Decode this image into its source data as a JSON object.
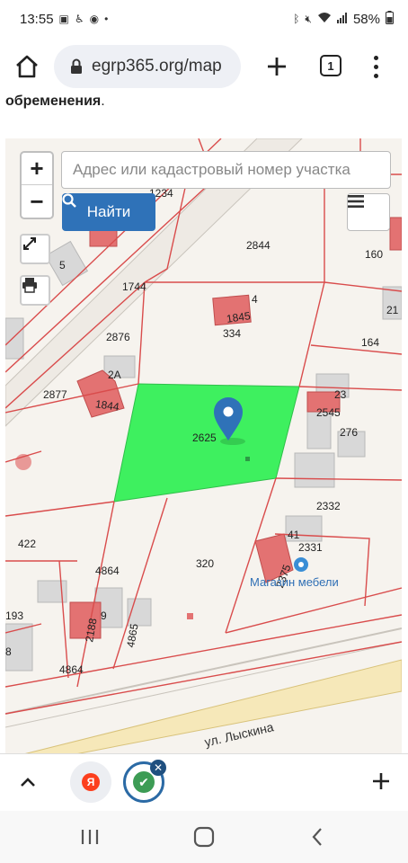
{
  "status_bar": {
    "time": "13:55",
    "battery": "58%",
    "left_icons": [
      "gallery-icon",
      "accessibility-icon",
      "chrome-icon",
      "dot"
    ],
    "right_icons": [
      "bluetooth-icon",
      "mute-icon",
      "wifi-icon",
      "signal-icon",
      "battery-icon"
    ]
  },
  "browser": {
    "url": "egrp365.org/map",
    "tab_count": "1"
  },
  "page": {
    "text_bold": "обременения",
    "text_dot": "."
  },
  "map": {
    "search_placeholder": "Адрес или кадастровый номер участка",
    "find_button": "Найти",
    "zoom_in": "+",
    "zoom_out": "−",
    "highlight_color": "#3ef05f",
    "parcel_line_color": "#d94c4c",
    "building_color": "#e37272",
    "parcel_labels": [
      "2844",
      "160",
      "1744",
      "4",
      "1845",
      "334",
      "21",
      "2876",
      "164",
      "2А",
      "23",
      "2877",
      "1844",
      "2545",
      "2625",
      "276",
      "2332",
      "41",
      "2331",
      "422",
      "320",
      "4864",
      "2375",
      "193",
      "2188",
      "9",
      "4865",
      "8",
      "4864",
      "5",
      "1234"
    ],
    "store_label": "Магазин мебели",
    "street_label": "ул. Лыскина"
  },
  "bottom_bar": {
    "yandex_letter": "Я",
    "check": "✔",
    "close": "✕"
  }
}
